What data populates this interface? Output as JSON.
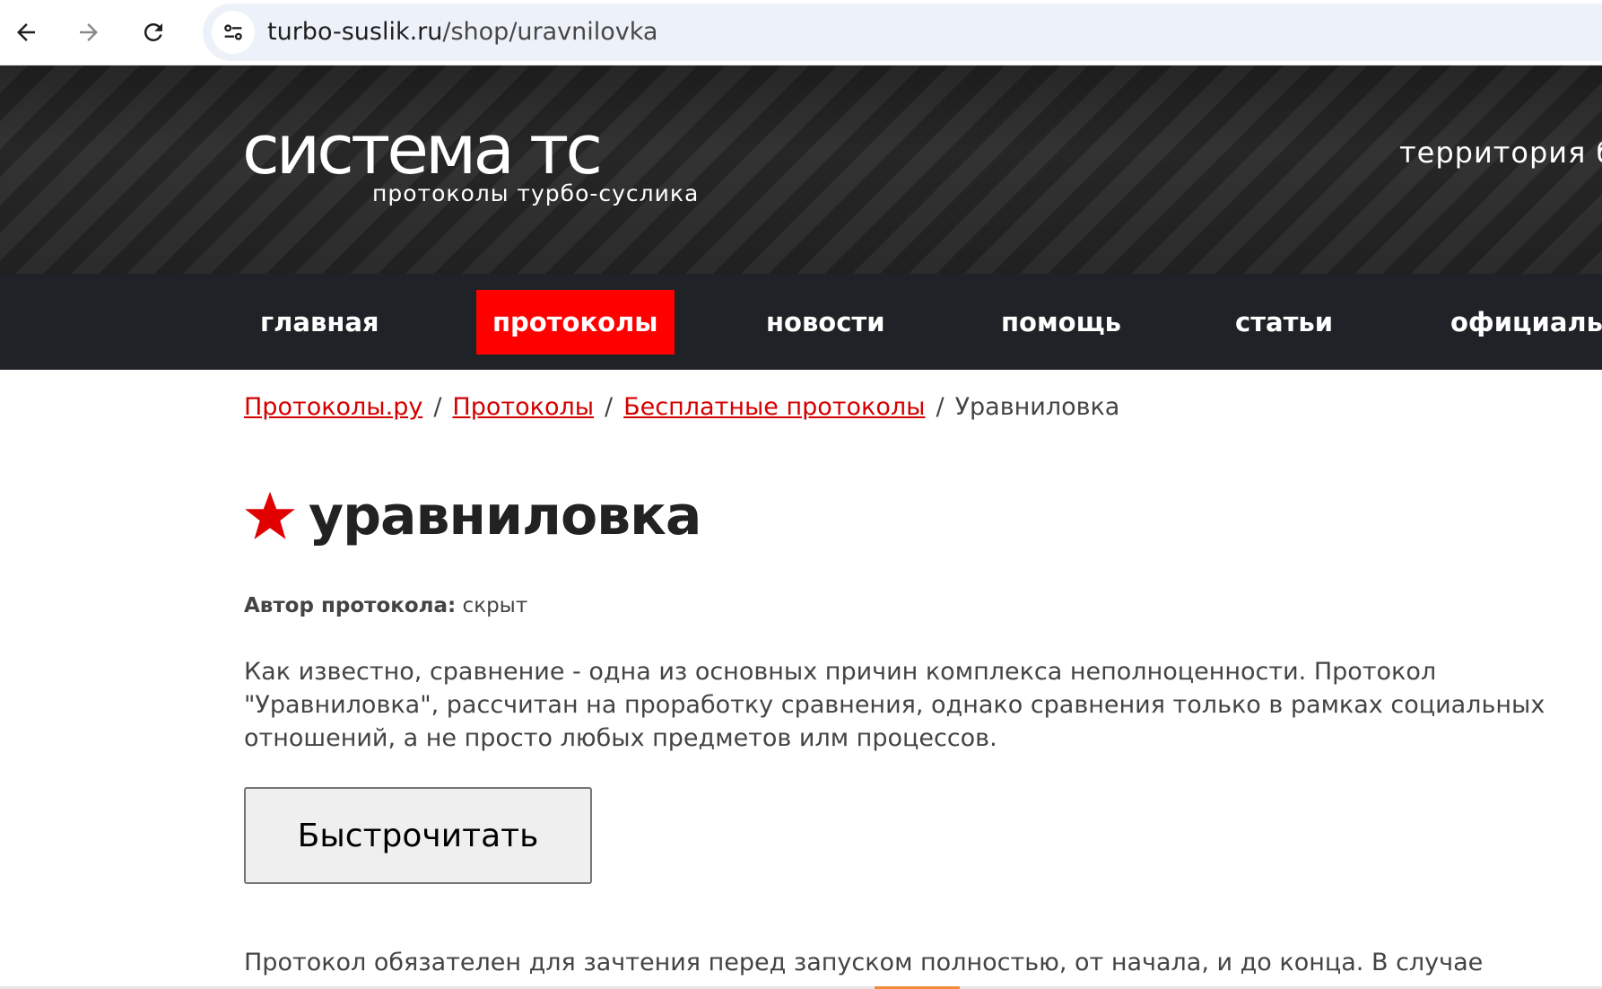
{
  "browser": {
    "url_domain": "turbo-suslik.ru",
    "url_path": "/shop/uravnilovka",
    "icons": [
      "back-arrow-icon",
      "forward-arrow-icon",
      "reload-icon",
      "site-settings-icon"
    ]
  },
  "header": {
    "logo_title": "система тс",
    "logo_subtitle": "протоколы турбо-суслика",
    "tagline": "территория бе"
  },
  "nav": {
    "items": [
      {
        "label": "главная",
        "active": false
      },
      {
        "label": "протоколы",
        "active": true
      },
      {
        "label": "новости",
        "active": false
      },
      {
        "label": "помощь",
        "active": false
      },
      {
        "label": "статьи",
        "active": false
      },
      {
        "label": "официальн",
        "active": false
      }
    ],
    "active_color": "#ff0000"
  },
  "breadcrumb": {
    "items": [
      "Протоколы.ру",
      "Протоколы",
      "Бесплатные протоколы"
    ],
    "current": "Уравниловка",
    "separator": "/",
    "link_color": "#d40000"
  },
  "page": {
    "title": "уравниловка",
    "title_icon": "star-icon",
    "star_color": "#e00000",
    "author_label": "Автор протокола:",
    "author_value": "скрыт",
    "description": "Как известно, сравнение - одна из основных причин комплекса неполноценности. Протокол \"Уравниловка\", рассчитан на проработку сравнения, однако сравнения только в рамках социальных отношений, а не просто любых предметов илм процессов.",
    "read_button": "Быстрочитать",
    "note": "Протокол обязателен для зачтения перед запуском полностью, от начала, и до конца. В случае"
  }
}
